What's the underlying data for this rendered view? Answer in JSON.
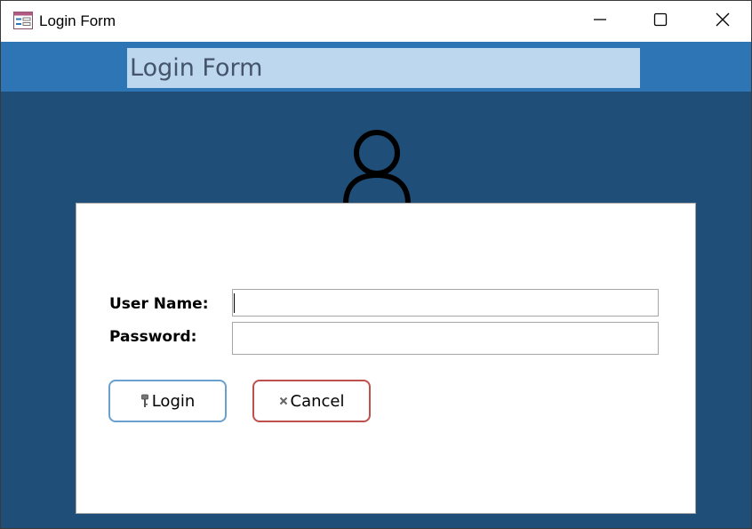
{
  "window": {
    "title": "Login Form"
  },
  "form": {
    "title": "Login Form",
    "username_label": "User Name:",
    "username_value": "",
    "password_label": "Password:",
    "password_value": ""
  },
  "buttons": {
    "login_label": "Login",
    "cancel_label": "Cancel"
  },
  "icons": {
    "app": "form-icon",
    "avatar": "user-icon",
    "login": "key-icon",
    "cancel": "close-x-icon",
    "minimize": "minimize-icon",
    "maximize": "maximize-icon",
    "close": "close-icon"
  },
  "colors": {
    "header_band": "#2e75b6",
    "title_highlight": "#bdd7ee",
    "title_text": "#44546a",
    "background": "#1f4e79",
    "login_border": "#6aa0d0",
    "cancel_border": "#c0504d"
  }
}
